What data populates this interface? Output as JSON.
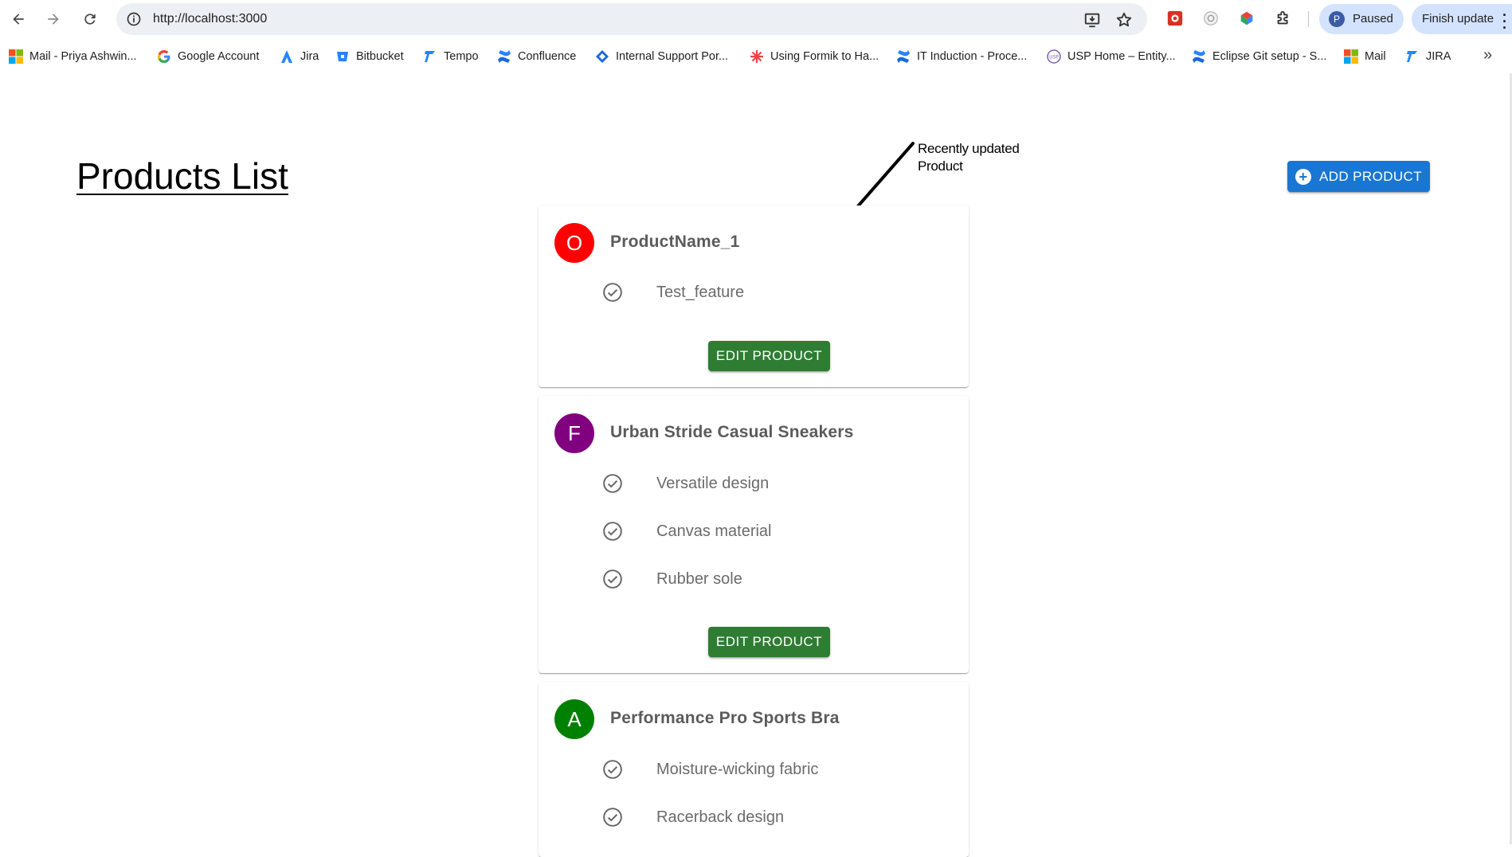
{
  "browser": {
    "url": "http://localhost:3000",
    "profile_initial": "P",
    "profile_status": "Paused",
    "update_label": "Finish update"
  },
  "bookmarks": [
    {
      "label": "Mail - Priya Ashwin...",
      "icon": "microsoft-icon"
    },
    {
      "label": "Google Account",
      "icon": "google-icon"
    },
    {
      "label": "Jira",
      "icon": "jira-icon"
    },
    {
      "label": "Bitbucket",
      "icon": "bitbucket-icon"
    },
    {
      "label": "Tempo",
      "icon": "tempo-icon"
    },
    {
      "label": "Confluence",
      "icon": "confluence-icon"
    },
    {
      "label": "Internal Support Por...",
      "icon": "support-portal-icon"
    },
    {
      "label": "Using Formik to Ha...",
      "icon": "formik-icon"
    },
    {
      "label": "IT Induction - Proce...",
      "icon": "confluence-icon"
    },
    {
      "label": "USP Home – Entity...",
      "icon": "usp-icon"
    },
    {
      "label": "Eclipse Git setup - S...",
      "icon": "confluence-icon"
    },
    {
      "label": "Mail",
      "icon": "microsoft-icon"
    },
    {
      "label": "JIRA",
      "icon": "tempo-icon"
    }
  ],
  "page": {
    "title": "Products List",
    "annotation": "Recently updated Product",
    "add_button": "ADD PRODUCT",
    "edit_button": "EDIT PRODUCT"
  },
  "products": [
    {
      "initial": "O",
      "avatar_color": "#ff0000",
      "name": "ProductName_1",
      "features": [
        "Test_feature"
      ]
    },
    {
      "initial": "F",
      "avatar_color": "#800080",
      "name": "Urban Stride Casual Sneakers",
      "features": [
        "Versatile design",
        "Canvas material",
        "Rubber sole"
      ]
    },
    {
      "initial": "A",
      "avatar_color": "#008000",
      "name": "Performance Pro Sports Bra",
      "features": [
        "Moisture-wicking fabric",
        "Racerback design"
      ]
    }
  ],
  "colors": {
    "add_button": "#1976d2",
    "edit_button": "#2e7d32"
  }
}
